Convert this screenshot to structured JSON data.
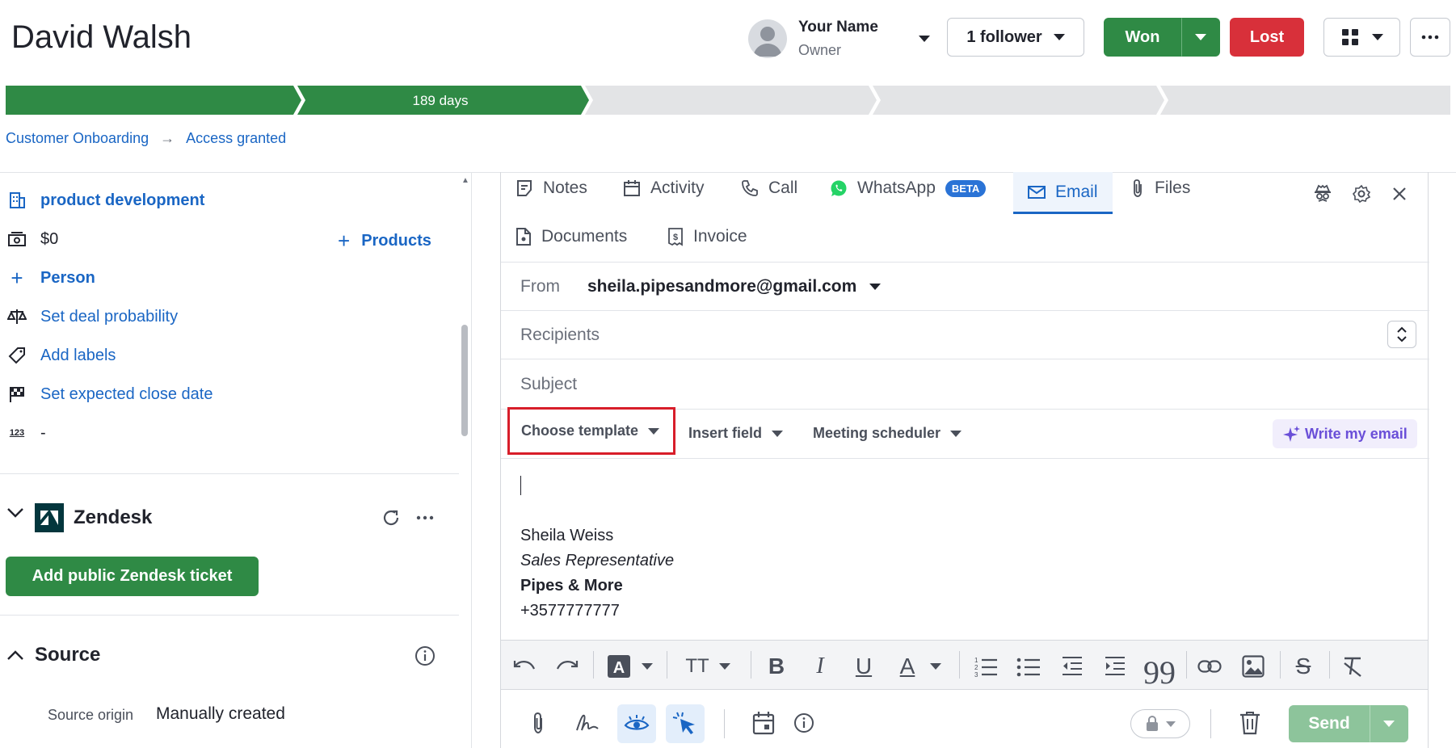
{
  "header": {
    "title": "David Walsh",
    "owner_name": "Your Name",
    "owner_role": "Owner",
    "follower_label": "1 follower",
    "won_label": "Won",
    "lost_label": "Lost"
  },
  "pipeline": {
    "active_stage_label": "189 days",
    "completed_stages": 2,
    "total_stages": 5,
    "colors": {
      "done": "#2f8a45",
      "todo": "#e3e4e6"
    }
  },
  "breadcrumb": {
    "pipeline": "Customer Onboarding",
    "stage": "Access granted"
  },
  "details": {
    "organization": "product development",
    "value": "$0",
    "products_label": "Products",
    "person_label": "Person",
    "probability_label": "Set deal probability",
    "labels_label": "Add labels",
    "close_date_label": "Set expected close date",
    "number_value": "-"
  },
  "zendesk": {
    "title": "Zendesk",
    "add_ticket_label": "Add public Zendesk ticket"
  },
  "source": {
    "title": "Source",
    "origin_label": "Source origin",
    "origin_value": "Manually created"
  },
  "tabs": {
    "notes": "Notes",
    "activity": "Activity",
    "call": "Call",
    "whatsapp": "WhatsApp",
    "beta": "BETA",
    "email": "Email",
    "files": "Files",
    "documents": "Documents",
    "invoice": "Invoice"
  },
  "email": {
    "from_label": "From",
    "from_value": "sheila.pipesandmore@gmail.com",
    "recipients_placeholder": "Recipients",
    "subject_placeholder": "Subject",
    "choose_template": "Choose template",
    "insert_field": "Insert field",
    "meeting_scheduler": "Meeting scheduler",
    "write_my_email": "Write my email",
    "send_label": "Send"
  },
  "signature": {
    "name": "Sheila Weiss",
    "title": "Sales Representative",
    "company": "Pipes & More",
    "phone": "+3577777777"
  },
  "colors": {
    "accent": "#1a66c4",
    "won": "#2f8a45",
    "lost": "#d8303a",
    "highlight_box": "#d81e2a",
    "ai": "#6a4fd8"
  }
}
